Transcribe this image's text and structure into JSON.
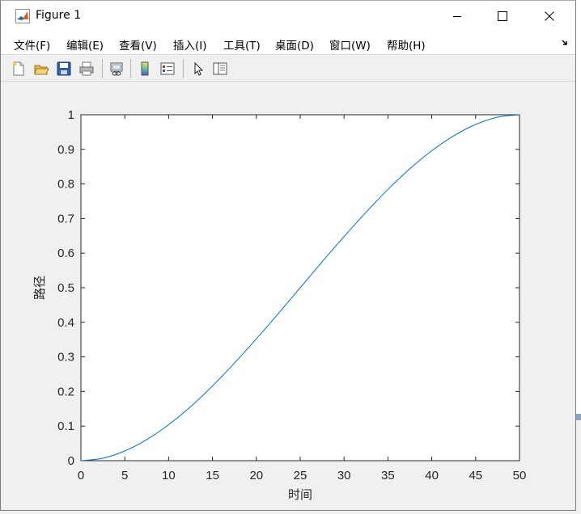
{
  "window": {
    "title": "Figure 1",
    "controls": [
      "minimize",
      "maximize",
      "close"
    ]
  },
  "menu": {
    "items": [
      {
        "label": "文件(F)"
      },
      {
        "label": "编辑(E)"
      },
      {
        "label": "查看(V)"
      },
      {
        "label": "插入(I)"
      },
      {
        "label": "工具(T)"
      },
      {
        "label": "桌面(D)"
      },
      {
        "label": "窗口(W)"
      },
      {
        "label": "帮助(H)"
      }
    ],
    "overflow_icon": "dock-arrow-icon"
  },
  "toolbar": {
    "icons": [
      "new-figure-icon",
      "open-file-icon",
      "save-icon",
      "print-icon",
      "link-plot-icon",
      "colorbar-icon",
      "legend-icon",
      "pointer-icon",
      "property-inspector-icon"
    ]
  },
  "chart_data": {
    "type": "line",
    "title": "",
    "xlabel": "时间",
    "ylabel": "路径",
    "xlim": [
      0,
      50
    ],
    "ylim": [
      0,
      1
    ],
    "xticks": [
      "0",
      "5",
      "10",
      "15",
      "20",
      "25",
      "30",
      "35",
      "40",
      "45",
      "50"
    ],
    "yticks": [
      "0",
      "0.1",
      "0.2",
      "0.3",
      "0.4",
      "0.5",
      "0.6",
      "0.7",
      "0.8",
      "0.9",
      "1"
    ],
    "grid": false,
    "line_color": "#0072bd",
    "series": [
      {
        "x": [
          0,
          2.5,
          5,
          7.5,
          10,
          12.5,
          15,
          17.5,
          20,
          22.5,
          25,
          27.5,
          30,
          32.5,
          35,
          37.5,
          40,
          42.5,
          45,
          47.5,
          50
        ],
        "y": [
          0,
          0.007,
          0.028,
          0.061,
          0.104,
          0.156,
          0.216,
          0.282,
          0.352,
          0.425,
          0.5,
          0.575,
          0.648,
          0.718,
          0.784,
          0.844,
          0.896,
          0.939,
          0.972,
          0.993,
          1.0
        ]
      }
    ]
  }
}
